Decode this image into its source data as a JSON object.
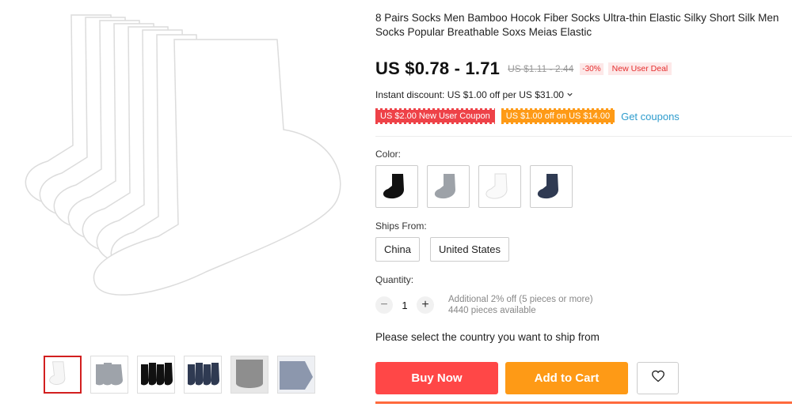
{
  "product": {
    "title": "8 Pairs Socks Men Bamboo Hocok Fiber Socks Ultra-thin Elastic Silky Short Silk Men Socks Popular Breathable Soxs Meias Elastic",
    "price": "US $0.78 - 1.71",
    "old_price": "US $1.11 - 2.44",
    "discount_pct": "-30%",
    "deal_badge": "New User Deal",
    "instant_discount": "Instant discount: US $1.00 off per US $31.00",
    "coupons": [
      "US $2.00 New User Coupon",
      "US $1.00 off on US $14.00"
    ],
    "get_coupons": "Get coupons"
  },
  "color": {
    "label": "Color:",
    "options": [
      "black",
      "gray",
      "white",
      "navy"
    ]
  },
  "ships_from": {
    "label": "Ships From:",
    "options": [
      "China",
      "United States"
    ]
  },
  "quantity": {
    "label": "Quantity:",
    "value": "1",
    "minus": "−",
    "plus": "+",
    "info_line1": "Additional 2% off (5 pieces or more)",
    "info_line2": "4440 pieces available"
  },
  "ship_message": "Please select the country you want to ship from",
  "buttons": {
    "buy_now": "Buy Now",
    "add_to_cart": "Add to Cart"
  },
  "colors": {
    "buy": "#ff4747",
    "cart": "#fe9a16",
    "link": "#2e9ccd",
    "active_thumb": "#d21f1f"
  },
  "thumbnails": [
    "white",
    "gray",
    "black",
    "navy",
    "gray-closeup",
    "blue-closeup"
  ]
}
